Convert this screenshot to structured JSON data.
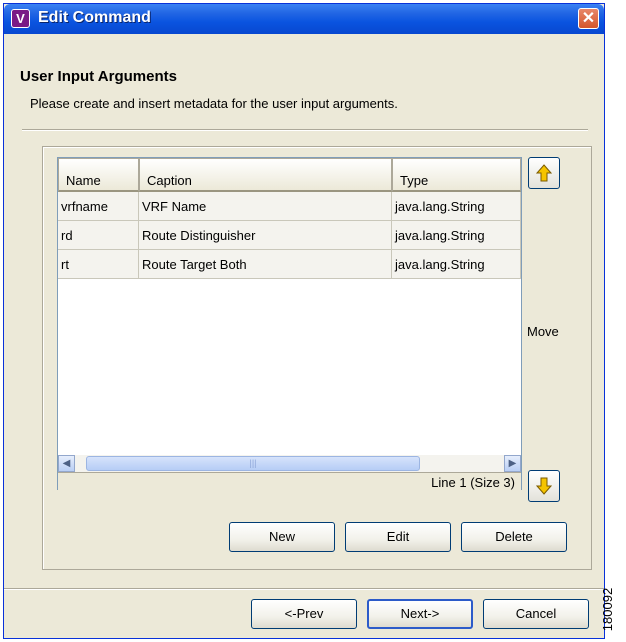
{
  "window": {
    "title": "Edit Command",
    "app_icon_letter": "V",
    "close_glyph": "✕"
  },
  "header": {
    "title": "User Input Arguments",
    "description": "Please create and insert metadata for the user input arguments."
  },
  "table": {
    "columns": [
      "Name",
      "Caption",
      "Type"
    ],
    "rows": [
      [
        "vrfname",
        "VRF Name",
        "java.lang.String"
      ],
      [
        "rd",
        "Route Distinguisher",
        "java.lang.String"
      ],
      [
        "rt",
        "Route Target Both",
        "java.lang.String"
      ]
    ],
    "status": "Line 1 (Size 3)",
    "scroll_thumb_grip": "|||"
  },
  "move": {
    "label": "Move",
    "up_icon": "arrow-up-icon",
    "down_icon": "arrow-down-icon",
    "arrow_color": "#f0b400"
  },
  "actions": {
    "new_label": "New",
    "edit_label": "Edit",
    "delete_label": "Delete"
  },
  "wizard": {
    "prev_label": "<-Prev",
    "next_label": "Next->",
    "cancel_label": "Cancel"
  },
  "figure_code": "180092",
  "colors": {
    "titlebar": "#0a54e0",
    "dialog_bg": "#ece9d8",
    "close_button": "#d5562b"
  }
}
